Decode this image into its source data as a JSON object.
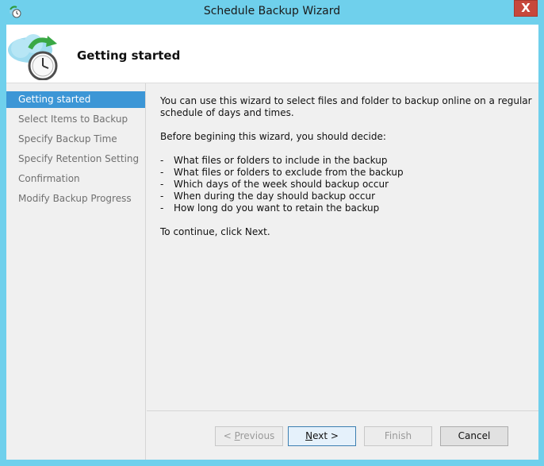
{
  "window": {
    "title": "Schedule Backup Wizard",
    "close_glyph": "X"
  },
  "header": {
    "title": "Getting started",
    "icon": "cloud-clock-backup-icon"
  },
  "nav": {
    "items": [
      {
        "label": "Getting started",
        "active": true
      },
      {
        "label": "Select Items to Backup",
        "active": false
      },
      {
        "label": "Specify Backup Time",
        "active": false
      },
      {
        "label": "Specify Retention Setting",
        "active": false
      },
      {
        "label": "Confirmation",
        "active": false
      },
      {
        "label": "Modify Backup Progress",
        "active": false
      }
    ]
  },
  "content": {
    "intro": "You can use this wizard to select files and folder to backup online on a regular schedule of days and times.",
    "decide": "Before begining this wizard, you should decide:",
    "bullet_marker": "-",
    "bullets": [
      "What files or folders to include in the backup",
      "What files or folders to exclude from the backup",
      "Which days of the week should backup occur",
      "When during the day should backup occur",
      "How long do you want to retain the backup"
    ],
    "continue": "To continue, click Next."
  },
  "buttons": {
    "previous": {
      "pre": "< ",
      "key": "P",
      "post": "revious",
      "enabled": false
    },
    "next": {
      "pre": "",
      "key": "N",
      "post": "ext >",
      "enabled": true
    },
    "finish": {
      "label": "Finish",
      "enabled": false
    },
    "cancel": {
      "label": "Cancel",
      "enabled": true
    }
  },
  "colors": {
    "titlebar": "#6fd0ec",
    "nav_active": "#3c96d6",
    "close_button": "#c7483c"
  }
}
